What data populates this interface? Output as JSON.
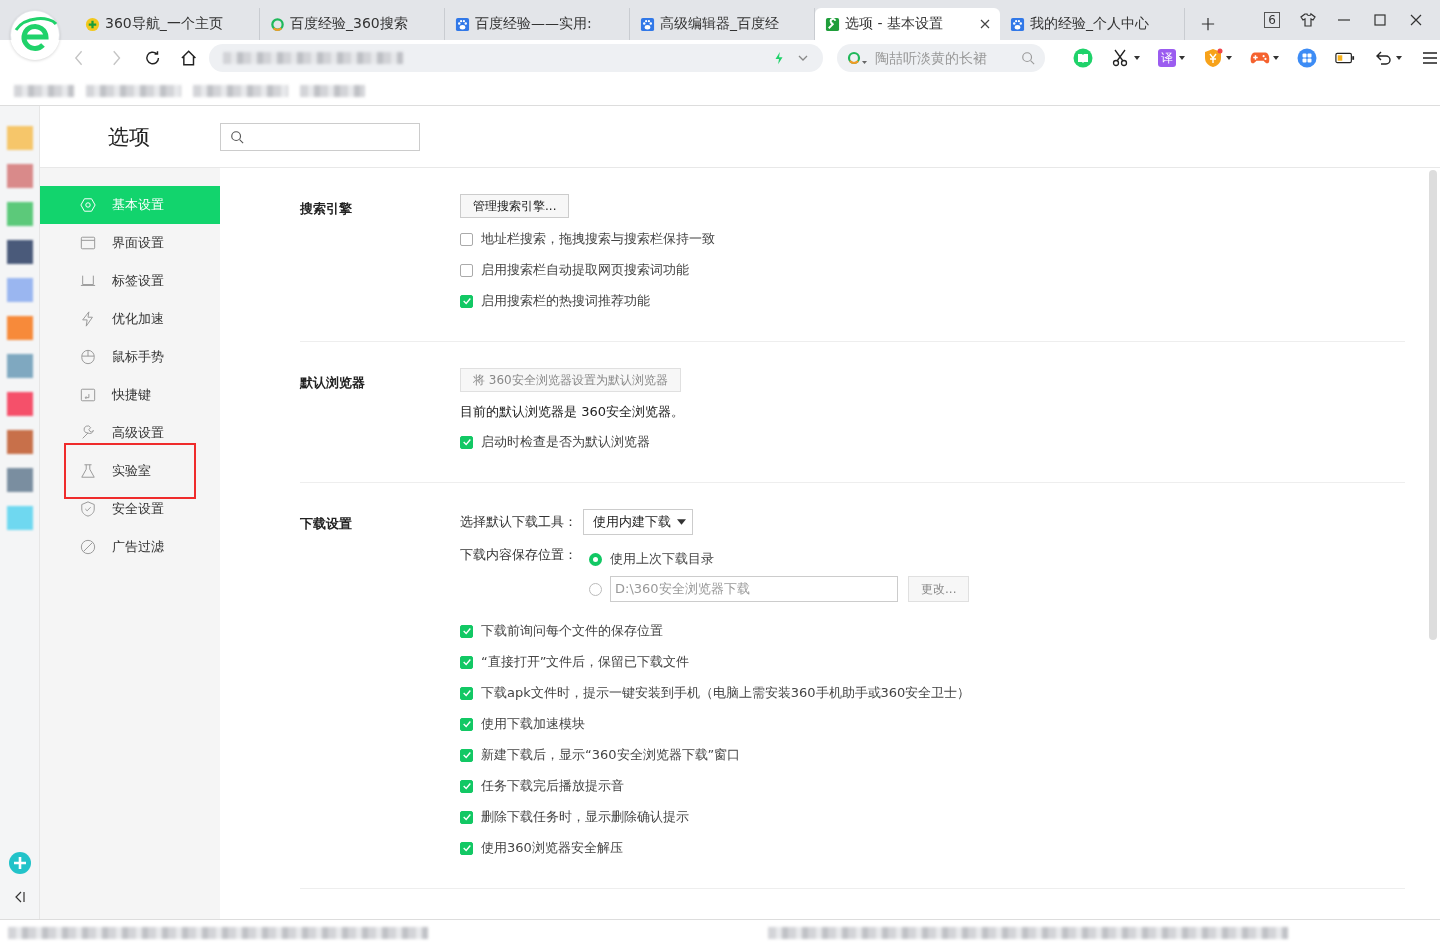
{
  "tabs": [
    {
      "kind": "nav360",
      "title": "360导航_一个主页",
      "selected": false
    },
    {
      "kind": "search360",
      "title": "百度经验_360搜索",
      "selected": false
    },
    {
      "kind": "paw",
      "title": "百度经验——实用:",
      "selected": false
    },
    {
      "kind": "paw",
      "title": "高级编辑器_百度经",
      "selected": false
    },
    {
      "kind": "wrench",
      "title": "选项 - 基本设置",
      "selected": true
    },
    {
      "kind": "paw",
      "title": "我的经验_个人中心",
      "selected": false
    }
  ],
  "tab_count": "6",
  "search": {
    "placeholder": "陶喆听淡黄的长裙"
  },
  "translate_label": "译",
  "page": {
    "title": "选项"
  },
  "nav": [
    {
      "kind": "gear",
      "label": "基本设置",
      "selected": true,
      "highlighted": false
    },
    {
      "kind": "window",
      "label": "界面设置",
      "selected": false,
      "highlighted": false
    },
    {
      "kind": "tab",
      "label": "标签设置",
      "selected": false,
      "highlighted": false
    },
    {
      "kind": "bolt",
      "label": "优化加速",
      "selected": false,
      "highlighted": false
    },
    {
      "kind": "mouse",
      "label": "鼠标手势",
      "selected": false,
      "highlighted": false
    },
    {
      "kind": "key",
      "label": "快捷键",
      "selected": false,
      "highlighted": false
    },
    {
      "kind": "wrench",
      "label": "高级设置",
      "selected": false,
      "highlighted": false
    },
    {
      "kind": "flask",
      "label": "实验室",
      "selected": false,
      "highlighted": true
    },
    {
      "kind": "shield",
      "label": "安全设置",
      "selected": false,
      "highlighted": false
    },
    {
      "kind": "block",
      "label": "广告过滤",
      "selected": false,
      "highlighted": false
    }
  ],
  "sections": [
    {
      "title": "搜索引擎",
      "items": [
        {
          "kind": "button",
          "label": "管理搜索引擎...",
          "disabled": false
        },
        {
          "kind": "checkbox",
          "label": "地址栏搜索，拖拽搜索与搜索栏保持一致",
          "checked": false
        },
        {
          "kind": "checkbox",
          "label": "启用搜索栏自动提取网页搜索词功能",
          "checked": false
        },
        {
          "kind": "checkbox",
          "label": "启用搜索栏的热搜词推荐功能",
          "checked": true
        }
      ]
    },
    {
      "title": "默认浏览器",
      "items": [
        {
          "kind": "button",
          "label": "将 360安全浏览器设置为默认浏览器",
          "disabled": true
        },
        {
          "kind": "text",
          "label": "目前的默认浏览器是 360安全浏览器。"
        },
        {
          "kind": "checkbox",
          "label": "启动时检查是否为默认浏览器",
          "checked": true
        }
      ]
    },
    {
      "title": "下载设置",
      "items": [
        {
          "kind": "select",
          "label": "选择默认下载工具：",
          "value": "使用内建下载"
        },
        {
          "kind": "radio",
          "label": "下载内容保存位置：",
          "options": [
            {
              "kind": "text",
              "label": "使用上次下载目录",
              "selected": true
            },
            {
              "kind": "path",
              "value": "D:\\360安全浏览器下载",
              "button": "更改...",
              "selected": false
            }
          ]
        },
        {
          "kind": "checkbox",
          "label": "下载前询问每个文件的保存位置",
          "checked": true
        },
        {
          "kind": "checkbox",
          "label": "“直接打开”文件后，保留已下载文件",
          "checked": true
        },
        {
          "kind": "checkbox",
          "label": "下载apk文件时，提示一键安装到手机（电脑上需安装360手机助手或360安全卫士）",
          "checked": true
        },
        {
          "kind": "checkbox",
          "label": "使用下载加速模块",
          "checked": true
        },
        {
          "kind": "checkbox",
          "label": "新建下载后，显示“360安全浏览器下载”窗口",
          "checked": true
        },
        {
          "kind": "checkbox",
          "label": "任务下载完后播放提示音",
          "checked": true
        },
        {
          "kind": "checkbox",
          "label": "删除下载任务时，显示删除确认提示",
          "checked": true
        },
        {
          "kind": "checkbox",
          "label": "使用360浏览器安全解压",
          "checked": true
        }
      ]
    }
  ]
}
